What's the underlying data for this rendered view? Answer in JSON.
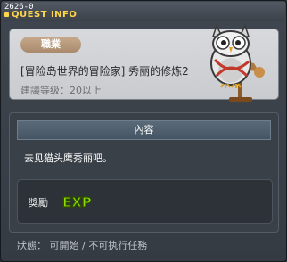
{
  "window": {
    "quest_id": "2626-0",
    "title": "QUEST INFO"
  },
  "quest": {
    "category": "職業",
    "name": "[冒险岛世界的冒险家] 秀丽的修炼2",
    "recommended_level": "建議等级：20以上"
  },
  "content": {
    "header": "內容",
    "description": "去见猫头鹰秀丽吧。"
  },
  "reward": {
    "label": "獎勵",
    "icon": "exp-icon",
    "icon_text": "EXP"
  },
  "status": {
    "text": "狀態： 可開始 / 不可执行任務"
  },
  "colors": {
    "title_yellow": "#ffd64a",
    "badge_brown": "#b8997c",
    "exp_green": "#8be000"
  }
}
